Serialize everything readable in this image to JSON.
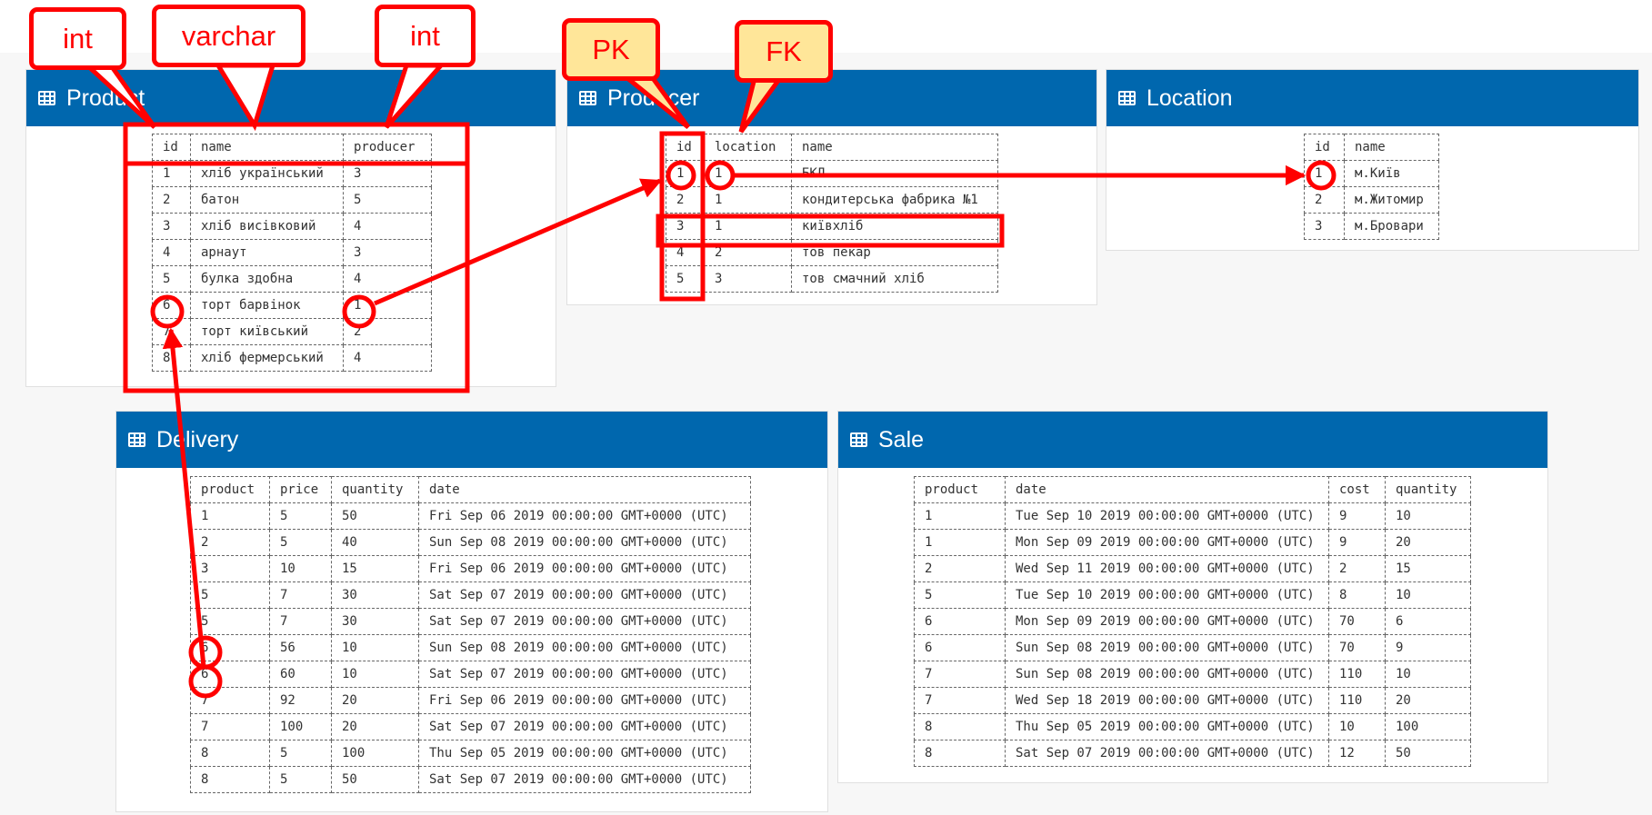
{
  "annotations": {
    "type_int_1": "int",
    "type_varchar": "varchar",
    "type_int_2": "int",
    "pk": "PK",
    "fk": "FK"
  },
  "colors": {
    "header": "#0067ae",
    "annotation": "#ff0000",
    "key_label_fill": "#ffe699"
  },
  "icons": {
    "table_icon": "table-grid-icon"
  },
  "tables": {
    "product": {
      "title": "Product",
      "columns": [
        "id",
        "name",
        "producer"
      ],
      "rows": [
        [
          "1",
          "хліб український",
          "3"
        ],
        [
          "2",
          "батон",
          "5"
        ],
        [
          "3",
          "хліб висівковий",
          "4"
        ],
        [
          "4",
          "арнаут",
          "3"
        ],
        [
          "5",
          "булка здобна",
          "4"
        ],
        [
          "6",
          "торт барвінок",
          "1"
        ],
        [
          "7",
          "торт київський",
          "2"
        ],
        [
          "8",
          "хліб фермерський",
          "4"
        ]
      ]
    },
    "producer": {
      "title": "Producer",
      "columns": [
        "id",
        "location",
        "name"
      ],
      "rows": [
        [
          "1",
          "1",
          "БКЛ"
        ],
        [
          "2",
          "1",
          "кондитерська фабрика №1"
        ],
        [
          "3",
          "1",
          "київхліб"
        ],
        [
          "4",
          "2",
          "тов пекар"
        ],
        [
          "5",
          "3",
          "тов смачний хліб"
        ]
      ]
    },
    "location": {
      "title": "Location",
      "columns": [
        "id",
        "name"
      ],
      "rows": [
        [
          "1",
          "м.Київ"
        ],
        [
          "2",
          "м.Житомир"
        ],
        [
          "3",
          "м.Бровари"
        ]
      ]
    },
    "delivery": {
      "title": "Delivery",
      "columns": [
        "product",
        "price",
        "quantity",
        "date"
      ],
      "rows": [
        [
          "1",
          "5",
          "50",
          "Fri Sep 06 2019 00:00:00 GMT+0000 (UTC)"
        ],
        [
          "2",
          "5",
          "40",
          "Sun Sep 08 2019 00:00:00 GMT+0000 (UTC)"
        ],
        [
          "3",
          "10",
          "15",
          "Fri Sep 06 2019 00:00:00 GMT+0000 (UTC)"
        ],
        [
          "5",
          "7",
          "30",
          "Sat Sep 07 2019 00:00:00 GMT+0000 (UTC)"
        ],
        [
          "5",
          "7",
          "30",
          "Sat Sep 07 2019 00:00:00 GMT+0000 (UTC)"
        ],
        [
          "6",
          "56",
          "10",
          "Sun Sep 08 2019 00:00:00 GMT+0000 (UTC)"
        ],
        [
          "6",
          "60",
          "10",
          "Sat Sep 07 2019 00:00:00 GMT+0000 (UTC)"
        ],
        [
          "7",
          "92",
          "20",
          "Fri Sep 06 2019 00:00:00 GMT+0000 (UTC)"
        ],
        [
          "7",
          "100",
          "20",
          "Sat Sep 07 2019 00:00:00 GMT+0000 (UTC)"
        ],
        [
          "8",
          "5",
          "100",
          "Thu Sep 05 2019 00:00:00 GMT+0000 (UTC)"
        ],
        [
          "8",
          "5",
          "50",
          "Sat Sep 07 2019 00:00:00 GMT+0000 (UTC)"
        ]
      ]
    },
    "sale": {
      "title": "Sale",
      "columns": [
        "product",
        "date",
        "cost",
        "quantity"
      ],
      "rows": [
        [
          "1",
          "Tue Sep 10 2019 00:00:00 GMT+0000 (UTC)",
          "9",
          "10"
        ],
        [
          "1",
          "Mon Sep 09 2019 00:00:00 GMT+0000 (UTC)",
          "9",
          "20"
        ],
        [
          "2",
          "Wed Sep 11 2019 00:00:00 GMT+0000 (UTC)",
          "2",
          "15"
        ],
        [
          "5",
          "Tue Sep 10 2019 00:00:00 GMT+0000 (UTC)",
          "8",
          "10"
        ],
        [
          "6",
          "Mon Sep 09 2019 00:00:00 GMT+0000 (UTC)",
          "70",
          "6"
        ],
        [
          "6",
          "Sun Sep 08 2019 00:00:00 GMT+0000 (UTC)",
          "70",
          "9"
        ],
        [
          "7",
          "Sun Sep 08 2019 00:00:00 GMT+0000 (UTC)",
          "110",
          "10"
        ],
        [
          "7",
          "Wed Sep 18 2019 00:00:00 GMT+0000 (UTC)",
          "110",
          "20"
        ],
        [
          "8",
          "Thu Sep 05 2019 00:00:00 GMT+0000 (UTC)",
          "10",
          "100"
        ],
        [
          "8",
          "Sat Sep 07 2019 00:00:00 GMT+0000 (UTC)",
          "12",
          "50"
        ]
      ]
    }
  }
}
